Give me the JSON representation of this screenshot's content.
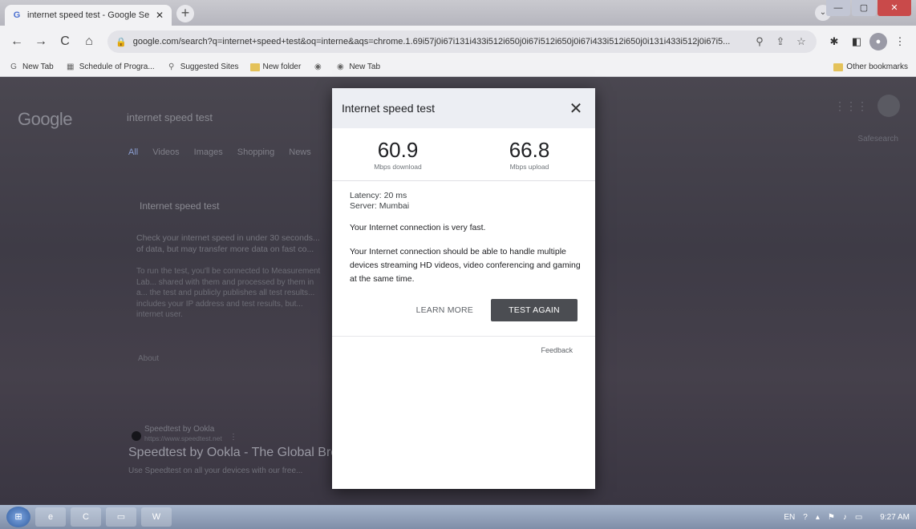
{
  "browser": {
    "tab_title": "internet speed test - Google Search",
    "tab_close": "✕",
    "new_tab": "+",
    "profile_menu": "⌄",
    "window": {
      "minimize": "—",
      "maximize": "▢",
      "close": "✕"
    },
    "nav": {
      "back": "←",
      "forward": "→",
      "reload": "C",
      "home": "⌂"
    },
    "url": "google.com/search?q=internet+speed+test&oq=interne&aqs=chrome.1.69i57j0i67i131i433i512i650j0i67i512i650j0i67i433i512i650j0i131i433i512j0i67i5...",
    "bookmarks": [
      {
        "label": "New Tab",
        "icon": "G"
      },
      {
        "label": "Schedule of Progra...",
        "icon": "calendar"
      },
      {
        "label": "Suggested Sites",
        "icon": "search"
      },
      {
        "label": "New folder",
        "icon": "folder"
      },
      {
        "label": "",
        "icon": "globe"
      },
      {
        "label": "New Tab",
        "icon": "globe"
      }
    ],
    "other_bookmarks": "Other bookmarks"
  },
  "background": {
    "logo": "Google",
    "query": "internet speed test",
    "tabs": [
      "All",
      "Videos",
      "Images",
      "Shopping",
      "News"
    ],
    "tools": "Safesearch",
    "snippet_title": "Internet speed test",
    "snippet_text": "Check your internet speed in under 30 seconds... of data, but may transfer more data on fast co...",
    "snippet_text2": "To run the test, you'll be connected to Measurement Lab... shared with them and processed by them in a... the test and publicly publishes all test results... includes your IP address and test results, but... internet user.",
    "about": "About",
    "result_site": "Speedtest by Ookla",
    "result_url": "https://www.speedtest.net",
    "result_more": "⋮",
    "result_title": "Speedtest by Ookla - The Global Broadband Speed Test",
    "result_desc": "Use Speedtest on all your devices with our free..."
  },
  "dialog": {
    "title": "Internet speed test",
    "close": "✕",
    "download_value": "60.9",
    "download_label": "Mbps download",
    "upload_value": "66.8",
    "upload_label": "Mbps upload",
    "latency": "Latency: 20 ms",
    "server": "Server: Mumbai",
    "message_short": "Your Internet connection is very fast.",
    "message_long": "Your Internet connection should be able to handle multiple devices streaming HD videos, video conferencing and gaming at the same time.",
    "learn_more": "LEARN MORE",
    "test_again": "TEST AGAIN",
    "feedback": "Feedback"
  },
  "taskbar": {
    "start": "⊞",
    "apps": [
      "e",
      "C",
      "▭",
      "W"
    ],
    "language": "EN",
    "clock": "9:27 AM"
  }
}
